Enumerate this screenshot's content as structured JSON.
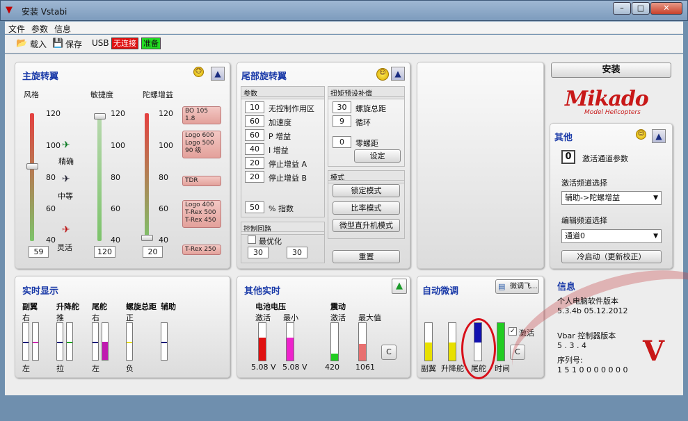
{
  "window": {
    "title": "安装 Vstabi",
    "min": "–",
    "max": "□",
    "close": "✕"
  },
  "menu": [
    "文件",
    "参数",
    "信息"
  ],
  "toolbar": {
    "load": "载入",
    "save": "保存",
    "usb": "USB",
    "not_connected": "无连接",
    "ready": "准备"
  },
  "main_rotor": {
    "title": "主旋转翼",
    "col_style": "风格",
    "col_agility": "敏捷度",
    "col_gyro": "陀螺增益",
    "ticks": [
      "120",
      "100",
      "80",
      "60",
      "40"
    ],
    "style_labels": [
      "精确",
      "中等",
      "灵活"
    ],
    "style_value": "59",
    "agility_value": "120",
    "gyro_value": "20",
    "style_level": 0.59,
    "agility_level": 1.0,
    "gyro_level": 0.0,
    "callouts": [
      "BO 105 1.8",
      "Logo 600\nLogo 500\n90 级",
      "TDR",
      "Logo 400\nT-Rex 500\nT-Rex 450",
      "T-Rex 250"
    ]
  },
  "tail_rotor": {
    "title": "尾部旋转翼",
    "params_header": "参数",
    "params": [
      {
        "value": "10",
        "label": "无控制作用区"
      },
      {
        "value": "60",
        "label": "加速度"
      },
      {
        "value": "60",
        "label": "P 增益"
      },
      {
        "value": "40",
        "label": "I 增益"
      },
      {
        "value": "20",
        "label": "停止增益 A"
      },
      {
        "value": "20",
        "label": "停止增益 B"
      }
    ],
    "exponent_value": "50",
    "exponent_label": "% 指数",
    "torque_header": "扭矩预设补偿",
    "torque": [
      {
        "value": "30",
        "label": "螺旋总距"
      },
      {
        "value": "9",
        "label": "循环"
      },
      {
        "value": "0",
        "label": "零螺距"
      }
    ],
    "set_button": "设定",
    "mode_header": "模式",
    "modes": [
      "锁定模式",
      "比率模式",
      "微型直升机模式"
    ],
    "control_loop_header": "控制回路",
    "optimize_label": "最优化",
    "loop_values": [
      "30",
      "30"
    ],
    "reset_button": "重置"
  },
  "install_button": "安装",
  "logo": {
    "brand": "Mikado",
    "tagline": "Model Helicopters"
  },
  "other": {
    "title": "其他",
    "activate_value": "0",
    "activate_label": "激活通道参数",
    "freq_label": "激活频道选择",
    "freq_value": "辅助->陀螺增益",
    "edit_label": "编辑频道选择",
    "edit_value": "通道0",
    "cold_start": "冷启动（更新校正）"
  },
  "realtime": {
    "title": "实时显示",
    "headers": [
      "副翼",
      "升降舵",
      "尾舵",
      "螺旋总距",
      "辅助"
    ],
    "top_labels": [
      "右",
      "推",
      "右",
      "正"
    ],
    "bottom_labels": [
      "左",
      "拉",
      "左",
      "负"
    ]
  },
  "other_realtime": {
    "title": "其他实时",
    "battery_label": "电池电压",
    "vib_label": "震动",
    "sub_labels": [
      "激活",
      "最小",
      "激活",
      "最大值"
    ],
    "values": [
      "5.08 V",
      "5.08 V",
      "420",
      "1061"
    ],
    "levels": [
      0.62,
      0.62,
      0.18,
      0.45
    ],
    "colors": [
      "#e01010",
      "#ee22cc",
      "#22cc22",
      "#e87070"
    ],
    "c_button": "C"
  },
  "auto_trim": {
    "title": "自动微调",
    "tune_button": "微调飞...",
    "bars": [
      "副翼",
      "升降舵",
      "尾舵",
      "时间"
    ],
    "activate_label": "激活",
    "c_button": "C"
  },
  "info": {
    "title": "信息",
    "pc_label": "个人电脑软件版本",
    "pc_version": "5.3.4b  05.12.2012",
    "vbar_label": "Vbar 控制器版本",
    "vbar_version": "5 . 3 . 4",
    "serial_label": "序列号:",
    "serial": "1 5 1 0 0 0 0 0 0 0"
  }
}
